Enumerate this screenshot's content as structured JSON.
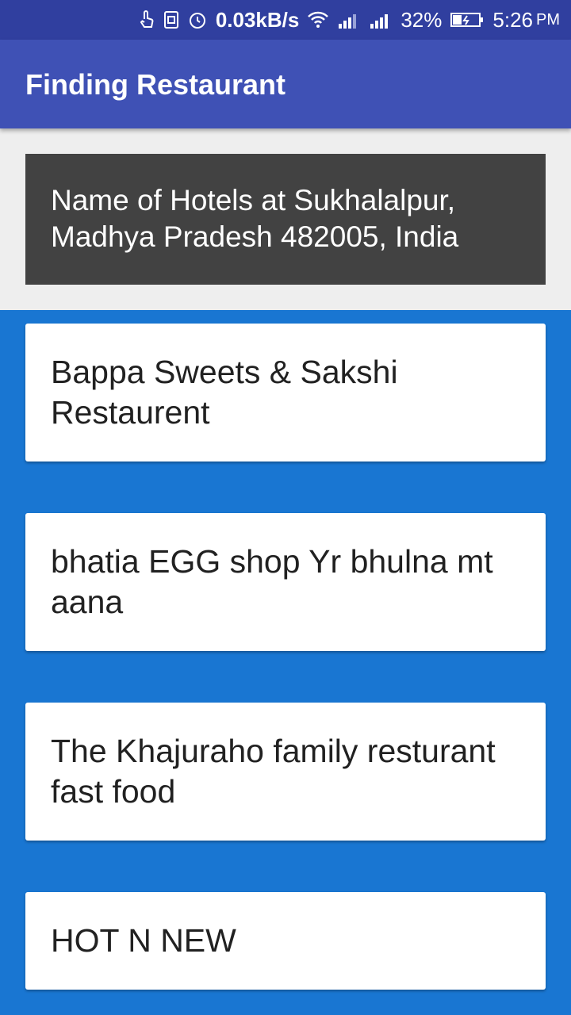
{
  "status_bar": {
    "icons": [
      "touch-icon",
      "screen-icon",
      "alarm-icon"
    ],
    "network_speed": "0.03kB/s",
    "wifi_icon": "wifi-icon",
    "signal_1_icon": "signal-sim1-icon",
    "signal_2_icon": "signal-sim2-icon",
    "battery_percent": "32%",
    "battery_icon": "battery-charging-icon",
    "time": "5:26",
    "ampm": "PM"
  },
  "app_bar": {
    "title": "Finding Restaurant",
    "color": "#3F51B5"
  },
  "location": {
    "text": "Name of Hotels at Sukhalalpur, Madhya Pradesh 482005, India"
  },
  "restaurants": [
    {
      "name": "Bappa Sweets & Sakshi Restaurent"
    },
    {
      "name": "bhatia EGG shop Yr bhulna mt aana"
    },
    {
      "name": "The Khajuraho family resturant fast food"
    },
    {
      "name": "HOT N NEW"
    }
  ],
  "colors": {
    "status_bar": "#303F9F",
    "list_background": "#1976D2",
    "header_background": "#EEEEEE",
    "location_box": "#424242"
  }
}
